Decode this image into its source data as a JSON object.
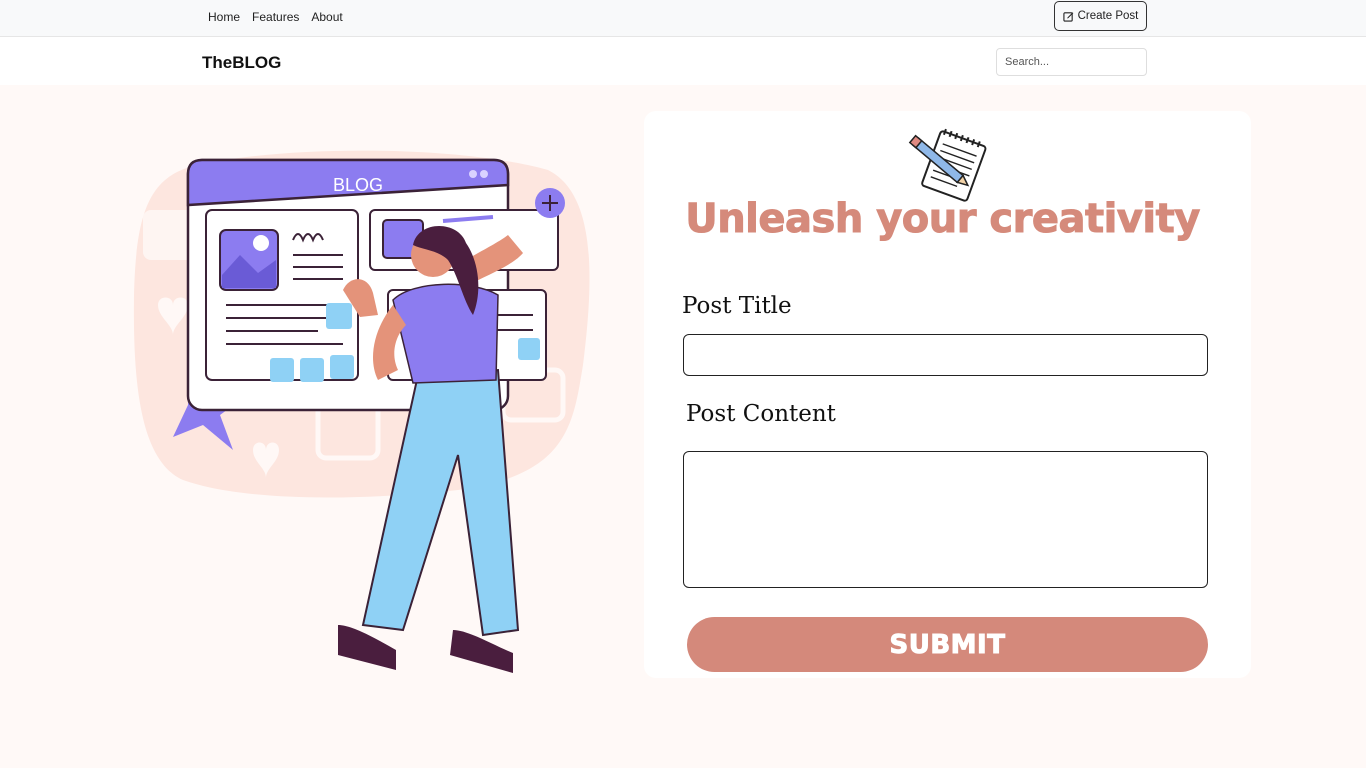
{
  "nav": {
    "links": [
      "Home",
      "Features",
      "About"
    ],
    "create_label": "Create Post"
  },
  "header": {
    "brand": "TheBLOG",
    "search_placeholder": "Search..."
  },
  "illustration": {
    "board_title": "BLOG"
  },
  "form": {
    "headline": "Unleash your creativity",
    "title_label": "Post Title",
    "title_value": "",
    "content_label": "Post Content",
    "content_value": "",
    "submit_label": "SUBMIT"
  },
  "colors": {
    "accent": "#d4897b",
    "purple": "#8c7cf0",
    "light_blue": "#8fd1f5",
    "blob": "#fde6df"
  }
}
